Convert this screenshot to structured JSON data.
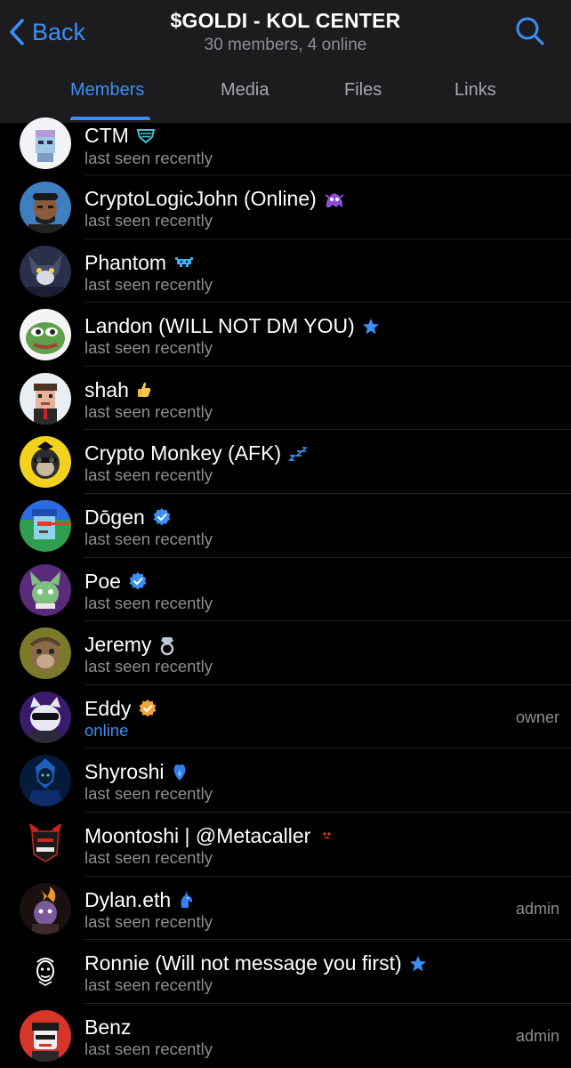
{
  "header": {
    "back_label": "Back",
    "title": "$GOLDI - KOL CENTER",
    "subtitle": "30 members, 4 online"
  },
  "tabs": [
    {
      "label": "Members"
    },
    {
      "label": "Media"
    },
    {
      "label": "Files"
    },
    {
      "label": "Links"
    }
  ],
  "members": [
    {
      "name": "CTM",
      "status": "last seen recently",
      "role": "",
      "emoji": "shield-blue-icon"
    },
    {
      "name": "CryptoLogicJohn (Online)",
      "status": "last seen recently",
      "role": "",
      "emoji": "purple-ghost-icon"
    },
    {
      "name": "Phantom",
      "status": "last seen recently",
      "role": "",
      "emoji": "space-invader-icon"
    },
    {
      "name": "Landon (WILL NOT DM YOU)",
      "status": "last seen recently",
      "role": "",
      "emoji": "star-icon"
    },
    {
      "name": "shah",
      "status": "last seen recently",
      "role": "",
      "emoji": "thumbs-up-icon"
    },
    {
      "name": "Crypto Monkey (AFK)",
      "status": "last seen recently",
      "role": "",
      "emoji": "sleep-zz-icon"
    },
    {
      "name": "Dōgen",
      "status": "last seen recently",
      "role": "",
      "emoji": "verified-blue-icon"
    },
    {
      "name": "Poe",
      "status": "last seen recently",
      "role": "",
      "emoji": "verified-blue-icon"
    },
    {
      "name": "Jeremy",
      "status": "last seen recently",
      "role": "",
      "emoji": "diamond-ring-icon"
    },
    {
      "name": "Eddy",
      "status": "online",
      "role": "owner",
      "emoji": "verified-gold-icon"
    },
    {
      "name": "Shyroshi",
      "status": "last seen recently",
      "role": "",
      "emoji": "blue-heart-icon"
    },
    {
      "name": "Moontoshi | @Metacaller",
      "status": "last seen recently",
      "role": "",
      "emoji": "tiny-face-icon"
    },
    {
      "name": "Dylan.eth",
      "status": "last seen recently",
      "role": "admin",
      "emoji": "blue-unicorn-icon"
    },
    {
      "name": "Ronnie (Will not message you first)",
      "status": "last seen recently",
      "role": "",
      "emoji": "star-icon"
    },
    {
      "name": "Benz",
      "status": "last seen recently",
      "role": "admin",
      "emoji": ""
    }
  ],
  "colors": {
    "accent": "#3a8ff7",
    "header_bg": "#1c1c1e",
    "secondary_text": "#8e8e93",
    "background": "#000000"
  }
}
